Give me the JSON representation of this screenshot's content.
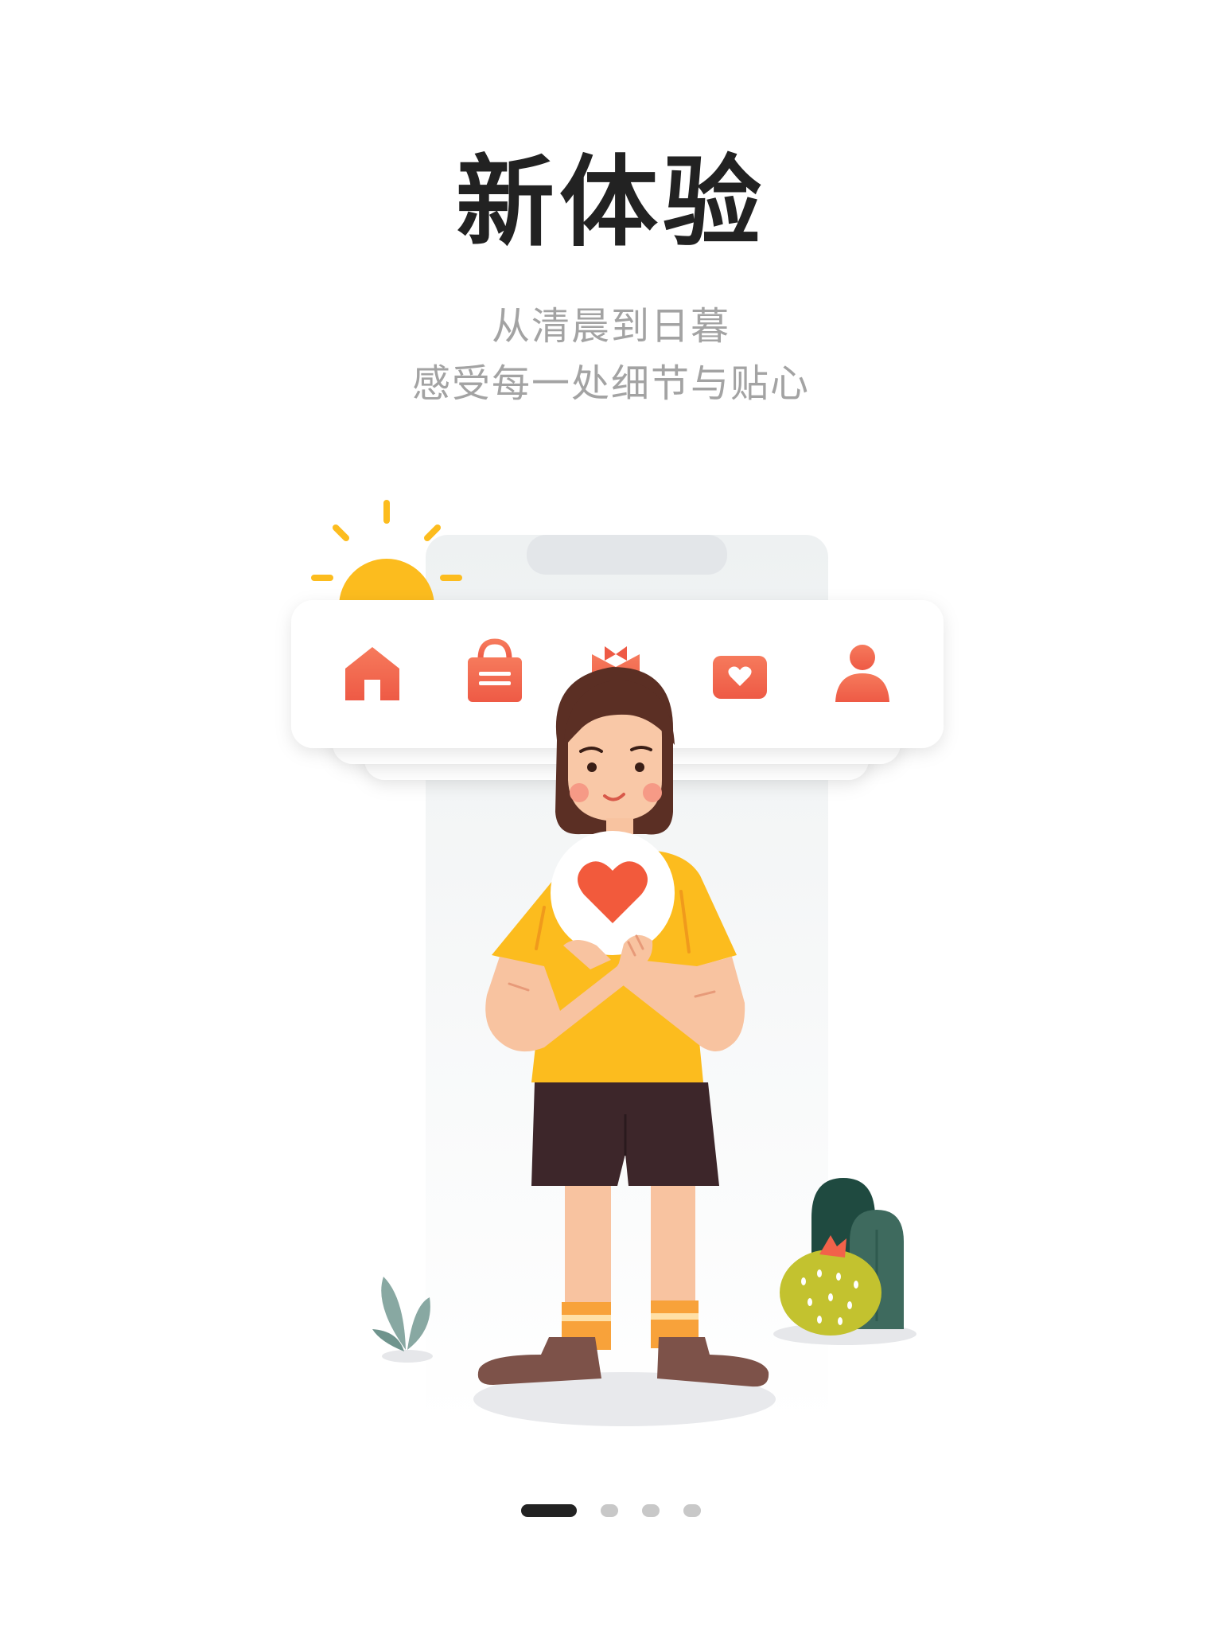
{
  "onboarding": {
    "title": "新体验",
    "subtitle_lines": [
      "从清晨到日暮",
      "感受每一处细节与贴心"
    ]
  },
  "illustration": {
    "tab_icons": [
      "home-icon",
      "shopping-bag-icon",
      "gift-icon",
      "heart-card-icon",
      "user-icon"
    ],
    "accent_color": "#f2624a",
    "sun_color": "#fcbc1e",
    "shirt_color": "#fcbc1e"
  },
  "pager": {
    "total": 4,
    "active_index": 0
  }
}
